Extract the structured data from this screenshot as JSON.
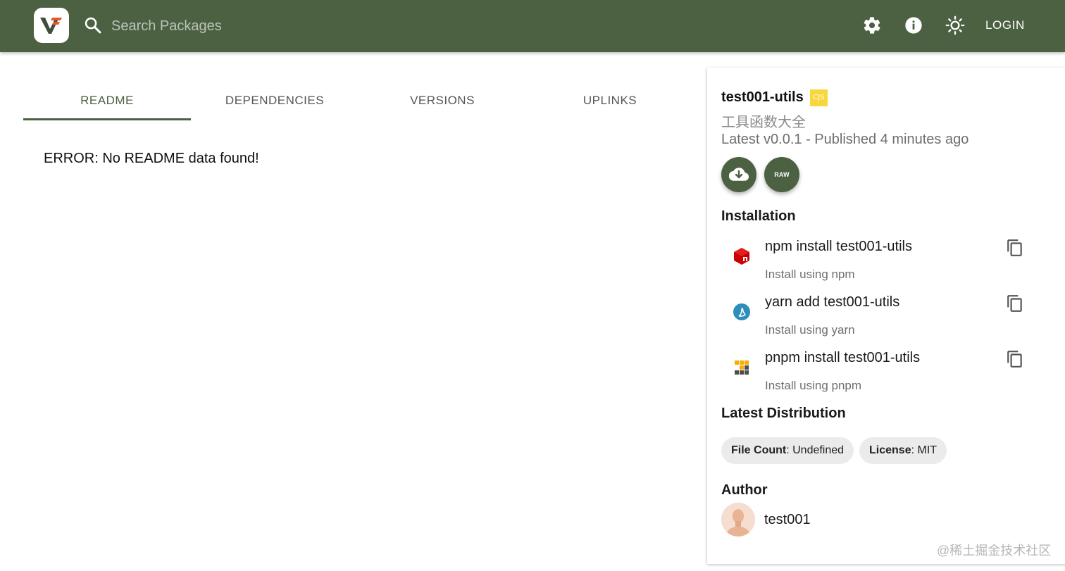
{
  "header": {
    "search_placeholder": "Search Packages",
    "login_label": "LOGIN",
    "icons": [
      "logo-icon",
      "search-icon",
      "gear-icon",
      "info-icon",
      "sun-icon"
    ],
    "background_color": "#4b6142"
  },
  "tabs": [
    {
      "label": "README",
      "active": true
    },
    {
      "label": "DEPENDENCIES",
      "active": false
    },
    {
      "label": "VERSIONS",
      "active": false
    },
    {
      "label": "UPLINKS",
      "active": false
    }
  ],
  "readme": {
    "error_text": "ERROR: No README data found!"
  },
  "package": {
    "name": "test001-utils",
    "module_badge": "CJS",
    "description": "工具函数大全",
    "latest": "Latest v0.0.1 - Published 4 minutes ago",
    "raw_label": "RAW"
  },
  "installation": {
    "title": "Installation",
    "items": [
      {
        "command": "npm install test001-utils",
        "subtitle": "Install using npm",
        "icon": "npm-icon"
      },
      {
        "command": "yarn add test001-utils",
        "subtitle": "Install using yarn",
        "icon": "yarn-icon"
      },
      {
        "command": "pnpm install test001-utils",
        "subtitle": "Install using pnpm",
        "icon": "pnpm-icon"
      }
    ]
  },
  "distribution": {
    "title": "Latest Distribution",
    "file_count_label": "File Count",
    "file_count_value": ": Undefined",
    "license_label": "License",
    "license_value": ": MIT"
  },
  "author": {
    "title": "Author",
    "name": "test001"
  },
  "watermark": "@稀土掘金技术社区",
  "colors": {
    "accent": "#4b6142",
    "badge": "#f7d73b",
    "npm": "#cb0000",
    "yarn": "#2c8ebb",
    "pnpm": "#f9ad00"
  }
}
